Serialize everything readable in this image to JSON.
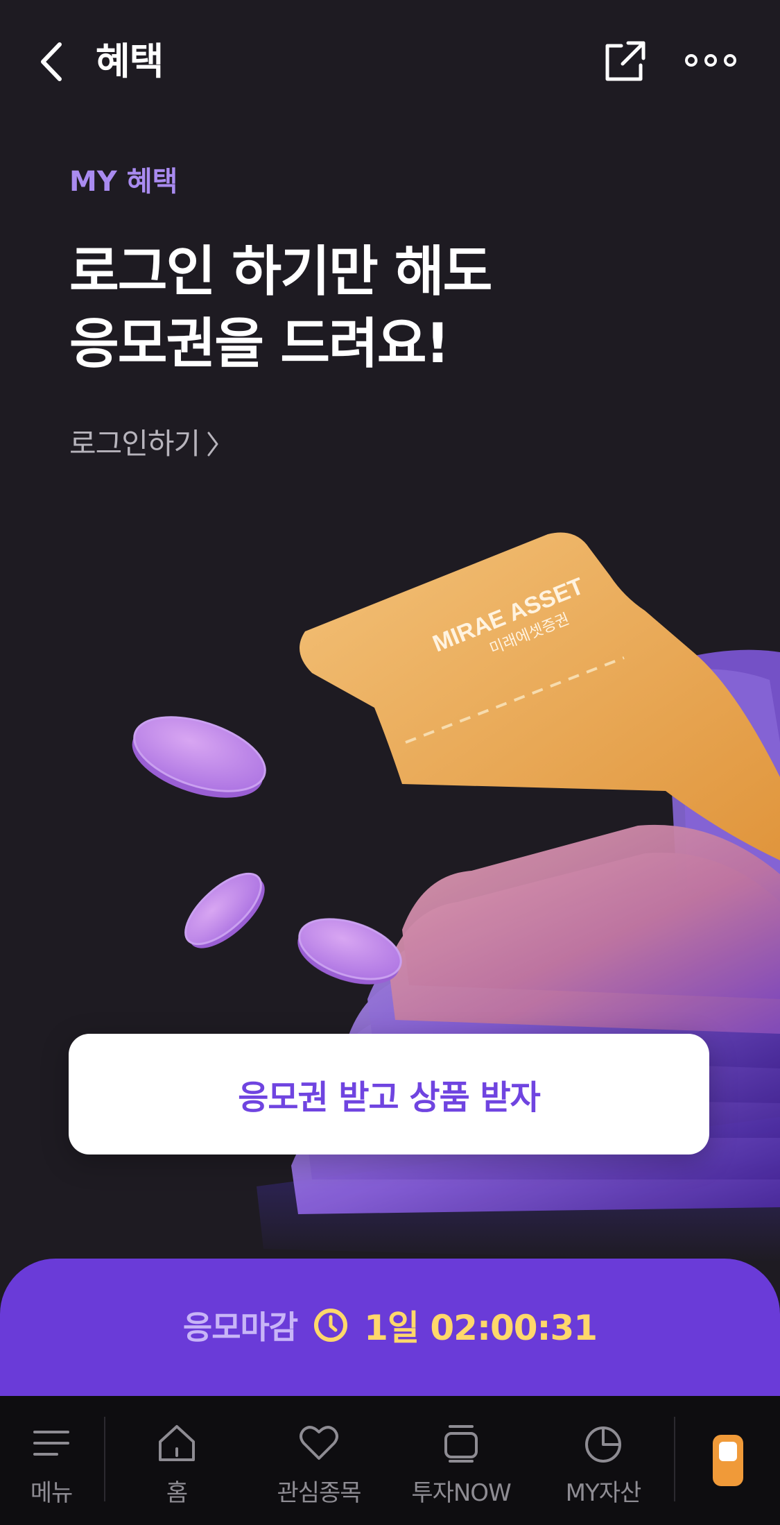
{
  "header": {
    "title": "혜택"
  },
  "hero": {
    "eyebrow": "MY 혜택",
    "headline_lines": [
      "로그인 하기만 해도",
      "응모권을 드려요!"
    ],
    "login_link": "로그인하기"
  },
  "illustration": {
    "ticket_brand": "MIRAE ASSET",
    "ticket_brand_sub": "미래에셋증권"
  },
  "cta": {
    "label": "응모권 받고 상품 받자"
  },
  "deadline": {
    "label": "응모마감",
    "countdown": "1일 02:00:31"
  },
  "tabbar": {
    "items": [
      {
        "label": "메뉴",
        "icon": "menu-icon"
      },
      {
        "label": "홈",
        "icon": "home-icon"
      },
      {
        "label": "관심종목",
        "icon": "heart-icon"
      },
      {
        "label": "투자NOW",
        "icon": "stack-icon"
      },
      {
        "label": "MY자산",
        "icon": "pie-chart-icon"
      }
    ]
  },
  "colors": {
    "background": "#1e1b22",
    "accent_purple": "#6a3bd8",
    "eyebrow": "#a98bf0",
    "countdown": "#ffd86b",
    "toggle_orange": "#f09a39"
  }
}
